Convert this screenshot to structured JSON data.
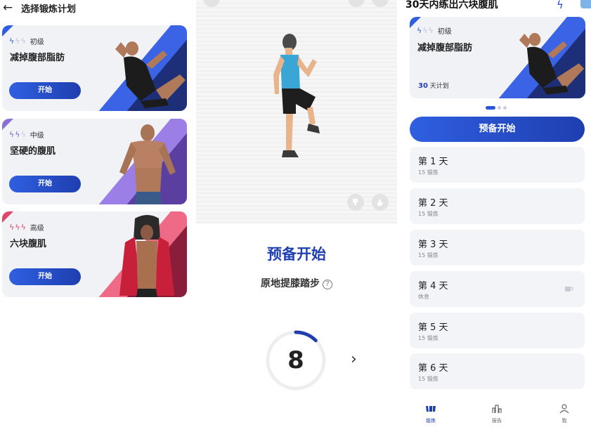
{
  "panel_left": {
    "header": {
      "back_icon": "arrow-left-icon",
      "title": "选择锻炼计划"
    },
    "plans": [
      {
        "level": "初级",
        "title": "减掉腹部脂肪",
        "button": "开始",
        "color": "#2f5fe0"
      },
      {
        "level": "中级",
        "title": "坚硬的腹肌",
        "button": "开始",
        "color": "#8a6fd6"
      },
      {
        "level": "高级",
        "title": "六块腹肌",
        "button": "开始",
        "color": "#e0456a"
      }
    ]
  },
  "panel_middle": {
    "ready_title": "预备开始",
    "exercise_name": "原地提膝踏步",
    "help_icon": "?",
    "countdown": "8",
    "countdown_progress": 0.125,
    "next_icon": "›"
  },
  "panel_right": {
    "title": "30天内练出六块腹肌",
    "banner": {
      "level": "初级",
      "title": "减掉腹部脂肪",
      "days": "30",
      "days_suffix": "天计划"
    },
    "ready_button": "预备开始",
    "days": [
      {
        "title": "第 1 天",
        "sub": "15 锻炼"
      },
      {
        "title": "第 2 天",
        "sub": "15 锻炼"
      },
      {
        "title": "第 3 天",
        "sub": "15 锻炼"
      },
      {
        "title": "第 4 天",
        "sub": "休息"
      },
      {
        "title": "第 5 天",
        "sub": "15 锻炼"
      },
      {
        "title": "第 6 天",
        "sub": "15 锻炼"
      }
    ],
    "nav": [
      {
        "label": "锻炼",
        "icon": "dumbbell-icon"
      },
      {
        "label": "报告",
        "icon": "bar-chart-icon"
      },
      {
        "label": "我",
        "icon": "user-icon"
      }
    ],
    "accent": "#1f3fb0"
  }
}
